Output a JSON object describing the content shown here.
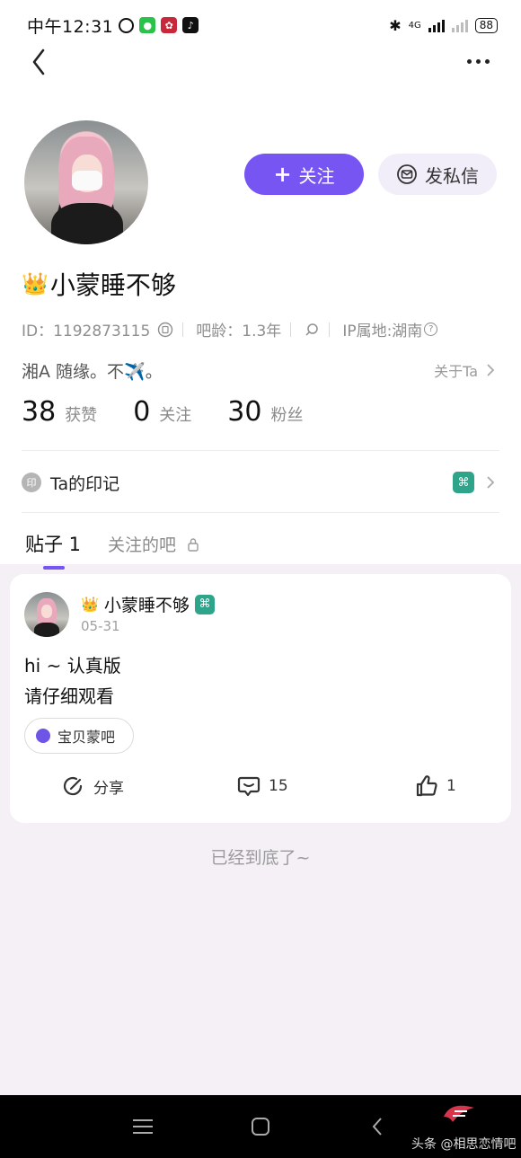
{
  "status_bar": {
    "time": "中午12:31",
    "network": "4G",
    "battery": "88"
  },
  "profile": {
    "follow_label": "关注",
    "message_label": "发私信",
    "crown": "👑",
    "username": "小蒙睡不够",
    "id_text": "ID：1192873115",
    "bar_age": "吧龄：1.3年",
    "ip_location": "IP属地:湖南",
    "bio": "湘A 随缘。不✈️。",
    "about_label": "关于Ta",
    "stats": [
      {
        "value": "38",
        "label": "获赞"
      },
      {
        "value": "0",
        "label": "关注"
      },
      {
        "value": "30",
        "label": "粉丝"
      }
    ],
    "mark_badge": "印",
    "mark_label": "Ta的印记"
  },
  "tabs": {
    "posts": "贴子 1",
    "followed_bars": "关注的吧"
  },
  "post": {
    "author": "小蒙睡不够",
    "crown": "👑",
    "date": "05-31",
    "lines": [
      "hi ~ 认真版",
      "请仔细观看"
    ],
    "bar_name": "宝贝蒙吧",
    "share_label": "分享",
    "comments": "15",
    "likes": "1"
  },
  "end_text": "已经到底了~",
  "watermark": "头条 @相思恋情吧"
}
